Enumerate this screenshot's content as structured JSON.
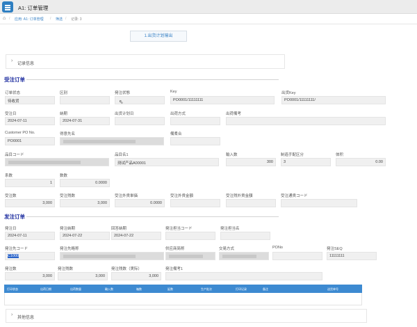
{
  "app": {
    "title": "A1: 订单管理"
  },
  "breadcrumb": {
    "item1": "应用: A1: 订单管理",
    "item2": "筛选",
    "item3": "记录: 3",
    "sep": "/"
  },
  "action": {
    "export_label": "1.出货计划输出"
  },
  "panels": {
    "records_label": "记录信息",
    "other_label": "其他信息"
  },
  "order": {
    "title": "受注订单",
    "labels": {
      "status": "订单状态",
      "region": "区别",
      "ship_status": "発注状態",
      "key": "Key",
      "ship_key": "出货Key",
      "order_date": "受注日",
      "due_date": "納期",
      "plan_date": "出货计划日",
      "ship_method": "出荷方式",
      "ship_note": "出荷備考",
      "customer_po": "Customer PO No.",
      "recipient": "得意先名",
      "note": "備柔合",
      "item_code": "品目コード",
      "item_name": "品目名1",
      "input_qty": "輸入数",
      "mfg_type": "制造手配区分",
      "volume": "体积",
      "coef": "系数",
      "count": "数数",
      "order_qty": "受注数",
      "remain_qty": "受注残数",
      "ext_price": "受注外貨単価",
      "ext_amount": "受注外貨金額",
      "ext_remain": "受注残外貨金額",
      "currency": "受注通貨コード"
    },
    "values": {
      "status": "待收货",
      "key": "PO0001/11111111",
      "ship_key": "PO0001/11111111/",
      "order_date": "2024-07-11",
      "due_date": "2024-07-31",
      "customer_po": "PO0001",
      "item_name": "测试产品A00001",
      "input_qty": "300",
      "mfg_type": "3",
      "volume": "0.00",
      "coef": "1",
      "count": "0.0000",
      "order_qty": "3,000",
      "remain_qty": "3,000",
      "ext_price": "0.0000"
    }
  },
  "purchase": {
    "title": "发注订单",
    "labels": {
      "order_date": "発注日",
      "due_date": "発注納期",
      "reply_date": "回答納期",
      "staff_code": "発注担当コード",
      "staff_name": "発注担当名",
      "vendor_code": "発注先コード",
      "vendor_name": "発注先略称",
      "supplier": "供应商简称",
      "trade_method": "交易方式",
      "pono": "PONo",
      "seq": "発注SEQ",
      "qty": "発注数",
      "remain": "発注残数",
      "actual_remain": "発注残数（実际）",
      "note": "発注備考1"
    },
    "values": {
      "order_date": "2024-07-11",
      "due_date": "2024-07-22",
      "reply_date": "2024-07-22",
      "vendor_code": "C1000",
      "seq": "11111111",
      "qty": "3,000",
      "remain": "3,000",
      "actual_remain": "3,000"
    }
  },
  "table": {
    "headers": [
      "打印状态",
      "出荷日期",
      "出荷数量",
      "輸入数",
      "箱数",
      "延数",
      "生产批次",
      "打印记录",
      "备注",
      "送货单号"
    ]
  }
}
